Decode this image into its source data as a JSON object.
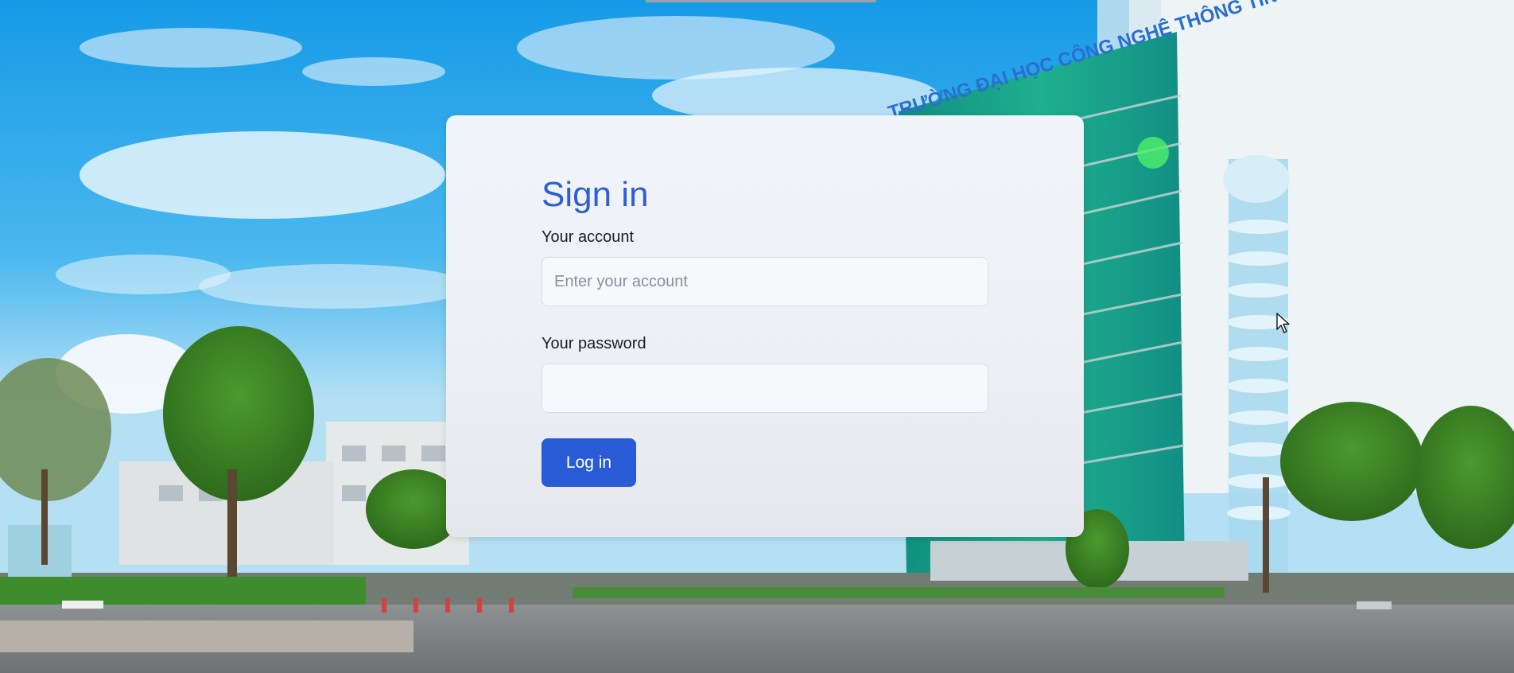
{
  "background": {
    "building_sign": "TRƯỜNG ĐẠI HỌC CÔNG NGHỆ THÔNG TIN",
    "sky_color": "#2aa3e8",
    "glass_color": "#1aa58c"
  },
  "login": {
    "title": "Sign in",
    "account_label": "Your account",
    "account_placeholder": "Enter your account",
    "account_value": "",
    "password_label": "Your password",
    "password_placeholder": "",
    "password_value": "",
    "submit_label": "Log in",
    "accent": "#2a5bd7"
  },
  "icons": {
    "cursor": "mouse-pointer-icon"
  }
}
